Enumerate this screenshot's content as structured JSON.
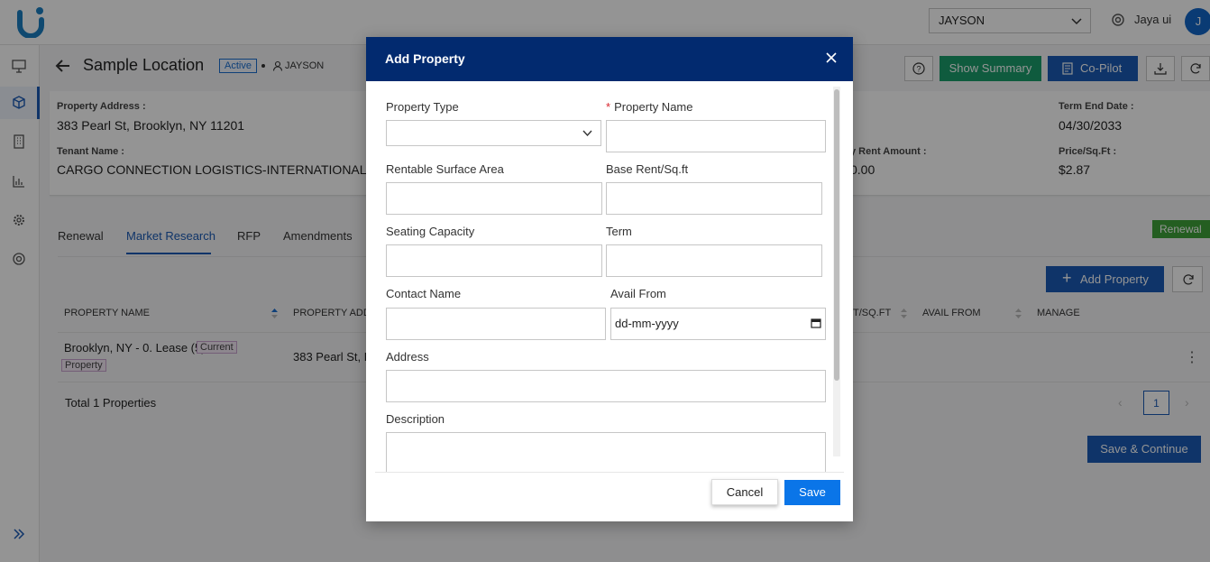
{
  "header": {
    "company": "JAYSON",
    "user_name": "Jaya ui",
    "avatar_initial": "J"
  },
  "page": {
    "title": "Sample Location",
    "status": "Active",
    "owner": "JAYSON",
    "buttons": {
      "show_summary": "Show Summary",
      "copilot": "Co-Pilot"
    }
  },
  "info": {
    "property_address_label": "Property Address :",
    "property_address": "383 Pearl St, Brooklyn, NY 11201",
    "tenant_name_label": "Tenant Name :",
    "tenant_name": "CARGO CONNECTION LOGISTICS-INTERNATIONAL",
    "term_end_label": "Term End Date :",
    "term_end": "04/30/2033",
    "rent_amount_label": "y Rent Amount :",
    "rent_amount": "0.00",
    "price_sqft_label": "Price/Sq.Ft :",
    "price_sqft": "$2.87"
  },
  "tabs": [
    "Renewal",
    "Market Research",
    "RFP",
    "Amendments"
  ],
  "renewal_flag": "Renewal",
  "list": {
    "add_button": "Add Property",
    "columns": [
      "PROPERTY NAME",
      "PROPERTY ADD",
      "T/SQ.FT",
      "AVAIL FROM",
      "MANAGE"
    ],
    "row": {
      "name": "Brooklyn, NY - 0. Lease (5)",
      "tag_line1": "Current",
      "tag_line2": "Property",
      "address": "383 Pearl St, B"
    },
    "total": "Total 1 Properties",
    "page": "1",
    "save_continue": "Save & Continue"
  },
  "modal": {
    "title": "Add Property",
    "fields": {
      "property_type": "Property Type",
      "property_name_required": "*",
      "property_name": "Property Name",
      "rentable_area": "Rentable Surface Area",
      "base_rent": "Base Rent/Sq.ft",
      "seating_capacity": "Seating Capacity",
      "term": "Term",
      "contact_name": "Contact Name",
      "avail_from": "Avail From",
      "avail_from_placeholder": "dd-mm-yyyy",
      "address": "Address",
      "description": "Description"
    },
    "cancel": "Cancel",
    "save": "Save"
  }
}
